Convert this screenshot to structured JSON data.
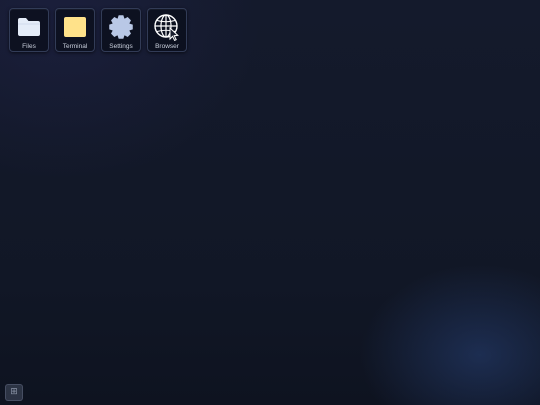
{
  "desktop": {
    "apps": [
      {
        "label": "Files",
        "icon": "folder-icon"
      },
      {
        "label": "Terminal",
        "icon": "terminal-icon"
      },
      {
        "label": "Settings",
        "icon": "gear-icon"
      },
      {
        "label": "Browser",
        "icon": "globe-icon"
      }
    ]
  },
  "taskbar": {
    "launcher_icon": "grid-icon",
    "launcher_glyph": "⊞"
  },
  "colors": {
    "folder": "#e4ecf8",
    "terminal": "#ffe28a",
    "settings": "#b9c8e6",
    "browser": "#ffffff"
  }
}
